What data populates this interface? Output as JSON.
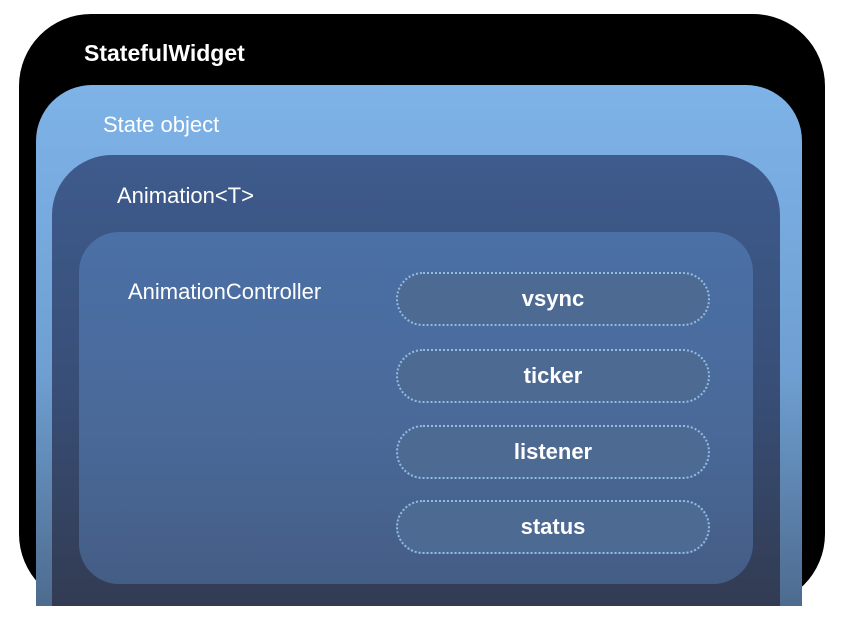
{
  "diagram": {
    "stateful_widget": {
      "label": "StatefulWidget"
    },
    "state_object": {
      "label": "State object"
    },
    "animation": {
      "label": "Animation<T>"
    },
    "animation_controller": {
      "label": "AnimationController",
      "parts": [
        "vsync",
        "ticker",
        "listener",
        "status"
      ]
    }
  },
  "colors": {
    "outer": "#000000",
    "state_object": "#7eb3e8",
    "animation": "#3e5b8d",
    "controller": "#4a70a6",
    "pill_fill": "#4d6a93",
    "pill_border": "#8fbbe6",
    "text": "#ffffff"
  }
}
